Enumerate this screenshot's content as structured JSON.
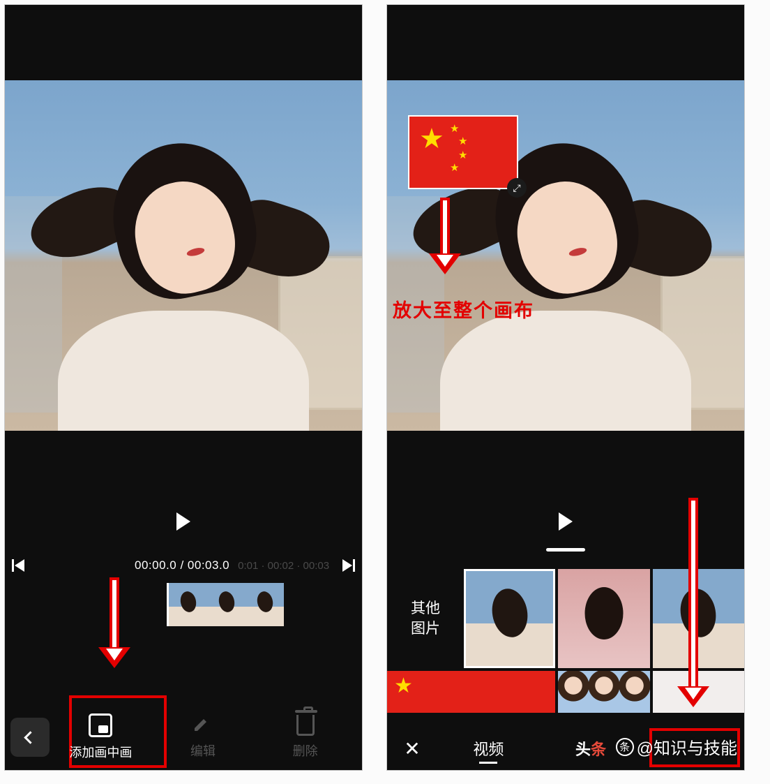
{
  "left": {
    "time_current": "00:00.0",
    "time_total": "00:03.0",
    "ticks": "0:01  ·  00:02  ·  00:03",
    "actions": {
      "add_pip": "添加画中画",
      "edit": "编辑",
      "delete": "删除"
    }
  },
  "right": {
    "annotation_label": "放大至整个画布",
    "other_pics_line1": "其他",
    "other_pics_line2": "图片",
    "tabs": {
      "video": "视频"
    },
    "toutiao_text": "头条",
    "watermark": "@知识与技能"
  }
}
